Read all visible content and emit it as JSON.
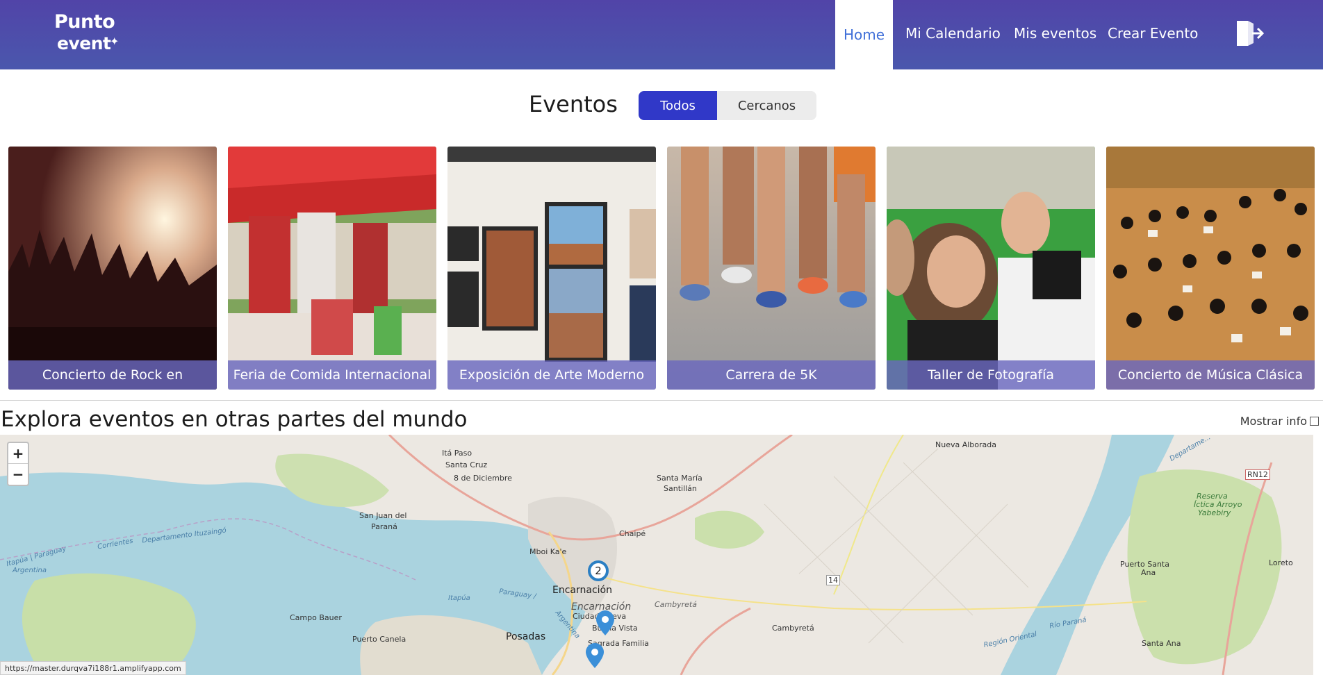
{
  "header": {
    "logo_line1": "Punto",
    "logo_line2": "event",
    "nav": {
      "home": "Home",
      "calendario": "Mi Calendario",
      "mis_eventos": "Mis eventos",
      "crear": "Crear Evento"
    },
    "logout_icon": "logout-icon"
  },
  "events": {
    "title": "Eventos",
    "filters": {
      "todos": "Todos",
      "cercanos": "Cercanos"
    },
    "cards": [
      {
        "label": "Concierto de Rock en"
      },
      {
        "label": "Feria de Comida Internacional"
      },
      {
        "label": "Exposición de Arte Moderno"
      },
      {
        "label": "Carrera de 5K"
      },
      {
        "label": "Taller de Fotografía"
      },
      {
        "label": "Concierto de Música Clásica"
      }
    ]
  },
  "explore": {
    "title": "Explora eventos en otras partes del mundo",
    "toggle_label": "Mostrar info"
  },
  "map": {
    "zoom_in": "+",
    "zoom_out": "−",
    "cluster_count": "2",
    "labels": {
      "ita_paso": "Itá Paso",
      "santa_cruz": "Santa Cruz",
      "ocho_dic": "8 de Diciembre",
      "san_juan": "San Juan del",
      "parana": "Paraná",
      "santa_maria": "Santa María",
      "santillan": "Santillán",
      "nueva_alborada": "Nueva Alborada",
      "chaipe": "Chaipé",
      "mboi": "Mboi Ka'e",
      "encarnacion": "Encarnación",
      "encarnacion2": "Encarnación",
      "ciudad_nueva": "Ciudad Nueva",
      "buena_vista": "Buena Vista",
      "cambyreta": "Cambyretá",
      "cambyreta2": "Cambyretá",
      "itapua": "Itapúa",
      "paraguay": "Paraguay",
      "argentina": "Argentina",
      "corrientes": "Corrientes",
      "dep_ituzaingo": "Departamento Ituzaingó",
      "itapua_py": "Itapúa | Paraguay",
      "argentina2": "Argentina",
      "itapua2": "Itapúa",
      "paraguay2": "Paraguay /",
      "argentina3": "Argentina",
      "campo_bauer": "Campo Bauer",
      "puerto_canela": "Puerto Canela",
      "posadas": "Posadas",
      "sagrada": "Sagrada Familia",
      "route14": "14",
      "rn12": "RN12",
      "reserva1": "Reserva",
      "reserva2": "Íctica Arroyo",
      "reserva3": "Yabebiry",
      "puerto_santa": "Puerto Santa",
      "ana": "Ana",
      "loreto": "Loreto",
      "region_oriental": "Región Oriental",
      "rio_parana": "Río Paraná",
      "santa_ana": "Santa Ana",
      "departamento": "Departame..."
    }
  },
  "status_url": "https://master.durqva7i188r1.amplifyapp.com"
}
